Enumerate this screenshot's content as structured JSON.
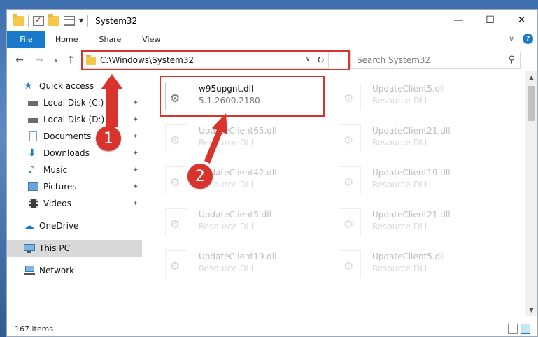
{
  "window": {
    "title": "System32",
    "controls": {
      "minimize": "—",
      "maximize": "☐",
      "close": "✕"
    }
  },
  "ribbon": {
    "file_tab": "File",
    "tabs": [
      "Home",
      "Share",
      "View"
    ],
    "help": "?"
  },
  "navigation": {
    "address": "C:\\Windows\\System32",
    "search_placeholder": "Search System32"
  },
  "sidebar": {
    "items": [
      {
        "label": "Quick access",
        "icon": "star-icon"
      },
      {
        "label": "Local Disk (C:)",
        "icon": "drive-icon",
        "pinned": true
      },
      {
        "label": "Local Disk (D:)",
        "icon": "drive-icon",
        "pinned": true
      },
      {
        "label": "Documents",
        "icon": "documents-icon",
        "pinned": true
      },
      {
        "label": "Downloads",
        "icon": "download-icon",
        "pinned": true
      },
      {
        "label": "Music",
        "icon": "music-icon",
        "pinned": true
      },
      {
        "label": "Pictures",
        "icon": "pictures-icon",
        "pinned": true
      },
      {
        "label": "Videos",
        "icon": "videos-icon",
        "pinned": true
      },
      {
        "label": "OneDrive",
        "icon": "cloud-icon"
      },
      {
        "label": "This PC",
        "icon": "computer-icon",
        "selected": true
      },
      {
        "label": "Network",
        "icon": "network-icon"
      }
    ]
  },
  "files": [
    {
      "name": "w95upgnt.dll",
      "sub": "5.1.2600.2180",
      "highlighted": true
    },
    {
      "name": "UpdateClient5.dll",
      "sub": "Resource DLL"
    },
    {
      "name": "UpdateClient65.dll",
      "sub": "Resource DLL"
    },
    {
      "name": "UpdateClient21.dll",
      "sub": "Resource DLL"
    },
    {
      "name": "UpdateClient42.dll",
      "sub": "Resource DLL"
    },
    {
      "name": "UpdateClient19.dll",
      "sub": "Resource DLL"
    },
    {
      "name": "UpdateClient5.dll",
      "sub": "Resource DLL"
    },
    {
      "name": "UpdateClient21.dll",
      "sub": "Resource DLL"
    },
    {
      "name": "UpdateClient19.dll",
      "sub": "Resource DLL"
    },
    {
      "name": "UpdateClient5.dll",
      "sub": "Resource DLL"
    }
  ],
  "status": {
    "item_count": "167 items"
  },
  "annotations": {
    "step1": "1",
    "step2": "2"
  },
  "colors": {
    "accent": "#1979ca",
    "highlight": "#d9332e"
  }
}
